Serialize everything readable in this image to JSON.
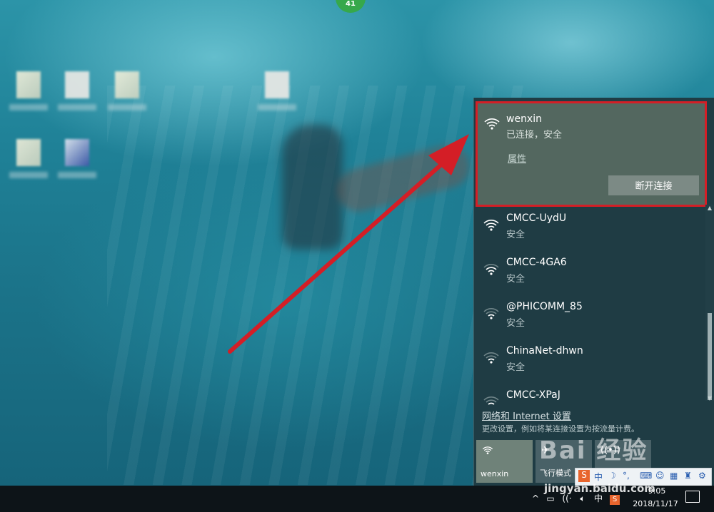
{
  "desktop": {
    "badge": "41"
  },
  "flyout": {
    "connected": {
      "ssid": "wenxin",
      "status": "已连接，安全",
      "properties": "属性",
      "disconnect": "断开连接"
    },
    "networks": [
      {
        "ssid": "CMCC-UydU",
        "status": "安全"
      },
      {
        "ssid": "CMCC-4GA6",
        "status": "安全"
      },
      {
        "ssid": "@PHICOMM_85",
        "status": "安全"
      },
      {
        "ssid": "ChinaNet-dhwn",
        "status": "安全"
      },
      {
        "ssid": "CMCC-XPaJ",
        "status": ""
      }
    ],
    "settings_link": "网络和 Internet 设置",
    "settings_desc": "更改设置，例如将某连接设置为按流量计费。",
    "tiles": {
      "wifi": "wenxin",
      "airplane": "飞行模式",
      "hotspot": ""
    }
  },
  "taskbar": {
    "ime_lang": "中",
    "time": "9:05",
    "date": "2018/11/17"
  },
  "ime_toolbar": {
    "s": "S",
    "lang": "中"
  },
  "watermark": {
    "brand": "Bai 经验",
    "url": "jingyan.baidu.com"
  },
  "colors": {
    "highlight": "#d41e26",
    "flyout_bg": "#1f3c44",
    "connected_bg": "#53675f"
  }
}
